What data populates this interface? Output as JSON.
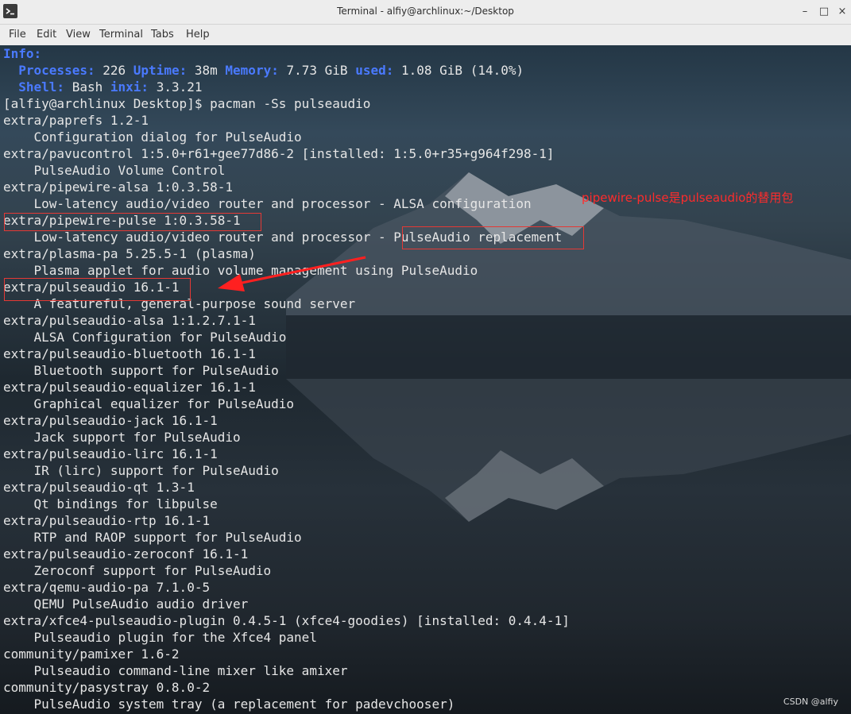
{
  "window": {
    "title": "Terminal - alfiy@archlinux:~/Desktop"
  },
  "window_controls": {
    "minimize": "–",
    "maximize": "□",
    "close": "×"
  },
  "menu": {
    "items": [
      "File",
      "Edit",
      "View",
      "Terminal",
      "Tabs",
      "Help"
    ]
  },
  "terminal": {
    "info": {
      "heading": "Info:",
      "processes_label": "Processes:",
      "processes_value": "226",
      "uptime_label": "Uptime:",
      "uptime_value": "38m",
      "memory_label": "Memory:",
      "memory_value": "7.73 GiB",
      "used_label": "used:",
      "used_value": "1.08 GiB (14.0%)",
      "shell_label": "Shell:",
      "shell_value": "Bash",
      "inxi_label": "inxi:",
      "inxi_value": "3.3.21"
    },
    "prompt": "[alfiy@archlinux Desktop]$ pacman -Ss pulseaudio",
    "output": [
      "extra/paprefs 1.2-1",
      "    Configuration dialog for PulseAudio",
      "extra/pavucontrol 1:5.0+r61+gee77d86-2 [installed: 1:5.0+r35+g964f298-1]",
      "    PulseAudio Volume Control",
      "extra/pipewire-alsa 1:0.3.58-1",
      "    Low-latency audio/video router and processor - ALSA configuration",
      "extra/pipewire-pulse 1:0.3.58-1",
      "    Low-latency audio/video router and processor - PulseAudio replacement",
      "extra/plasma-pa 5.25.5-1 (plasma)",
      "    Plasma applet for audio volume management using PulseAudio",
      "extra/pulseaudio 16.1-1",
      "    A featureful, general-purpose sound server",
      "extra/pulseaudio-alsa 1:1.2.7.1-1",
      "    ALSA Configuration for PulseAudio",
      "extra/pulseaudio-bluetooth 16.1-1",
      "    Bluetooth support for PulseAudio",
      "extra/pulseaudio-equalizer 16.1-1",
      "    Graphical equalizer for PulseAudio",
      "extra/pulseaudio-jack 16.1-1",
      "    Jack support for PulseAudio",
      "extra/pulseaudio-lirc 16.1-1",
      "    IR (lirc) support for PulseAudio",
      "extra/pulseaudio-qt 1.3-1",
      "    Qt bindings for libpulse",
      "extra/pulseaudio-rtp 16.1-1",
      "    RTP and RAOP support for PulseAudio",
      "extra/pulseaudio-zeroconf 16.1-1",
      "    Zeroconf support for PulseAudio",
      "extra/qemu-audio-pa 7.1.0-5",
      "    QEMU PulseAudio audio driver",
      "extra/xfce4-pulseaudio-plugin 0.4.5-1 (xfce4-goodies) [installed: 0.4.4-1]",
      "    Pulseaudio plugin for the Xfce4 panel",
      "community/pamixer 1.6-2",
      "    Pulseaudio command-line mixer like amixer",
      "community/pasystray 0.8.0-2",
      "    PulseAudio system tray (a replacement for padevchooser)"
    ]
  },
  "annotation": {
    "note": "pipewire-pulse是pulseaudio的替用包",
    "color": "#ff2b2b"
  },
  "watermark": "CSDN @alfiy",
  "colors": {
    "accent_label": "#4a7aff",
    "text": "#e6e6e6",
    "highlight_box": "#e53935"
  }
}
